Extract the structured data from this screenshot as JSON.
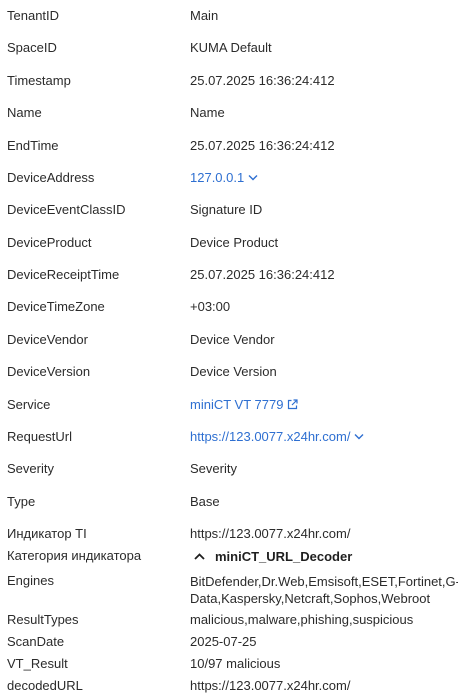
{
  "rows": [
    {
      "key": "TenantID",
      "value": "Main"
    },
    {
      "key": "SpaceID",
      "value": "KUMA Default"
    },
    {
      "key": "Timestamp",
      "value": "25.07.2025 16:36:24:412"
    },
    {
      "key": "Name",
      "value": "Name"
    },
    {
      "key": "EndTime",
      "value": "25.07.2025 16:36:24:412"
    },
    {
      "key": "DeviceAddress",
      "value": "127.0.0.1"
    },
    {
      "key": "DeviceEventClassID",
      "value": "Signature ID"
    },
    {
      "key": "DeviceProduct",
      "value": "Device Product"
    },
    {
      "key": "DeviceReceiptTime",
      "value": "25.07.2025 16:36:24:412"
    },
    {
      "key": "DeviceTimeZone",
      "value": "+03:00"
    },
    {
      "key": "DeviceVendor",
      "value": "Device Vendor"
    },
    {
      "key": "DeviceVersion",
      "value": "Device Version"
    },
    {
      "key": "Service",
      "value": "miniCT VT 7779"
    },
    {
      "key": "RequestUrl",
      "value": "https://123.0077.x24hr.com/"
    },
    {
      "key": "Severity",
      "value": "Severity"
    },
    {
      "key": "Type",
      "value": "Base"
    }
  ],
  "ti": {
    "indicator_key": "Индикатор TI",
    "indicator_value": "https://123.0077.x24hr.com/",
    "category_key": "Категория индикатора",
    "category_value": "miniCT_URL_Decoder",
    "engines_key": "Engines",
    "engines_value": "BitDefender,Dr.Web,Emsisoft,ESET,Fortinet,G-Data,Kaspersky,Netcraft,Sophos,Webroot",
    "resulttypes_key": "ResultTypes",
    "resulttypes_value": "malicious,malware,phishing,suspicious",
    "scandate_key": "ScanDate",
    "scandate_value": "2025-07-25",
    "vtresult_key": "VT_Result",
    "vtresult_value": "10/97 malicious",
    "decodedurl_key": "decodedURL",
    "decodedurl_value": "https://123.0077.x24hr.com/"
  },
  "colors": {
    "link": "#2e6fd1",
    "text": "#2b2b2b"
  }
}
